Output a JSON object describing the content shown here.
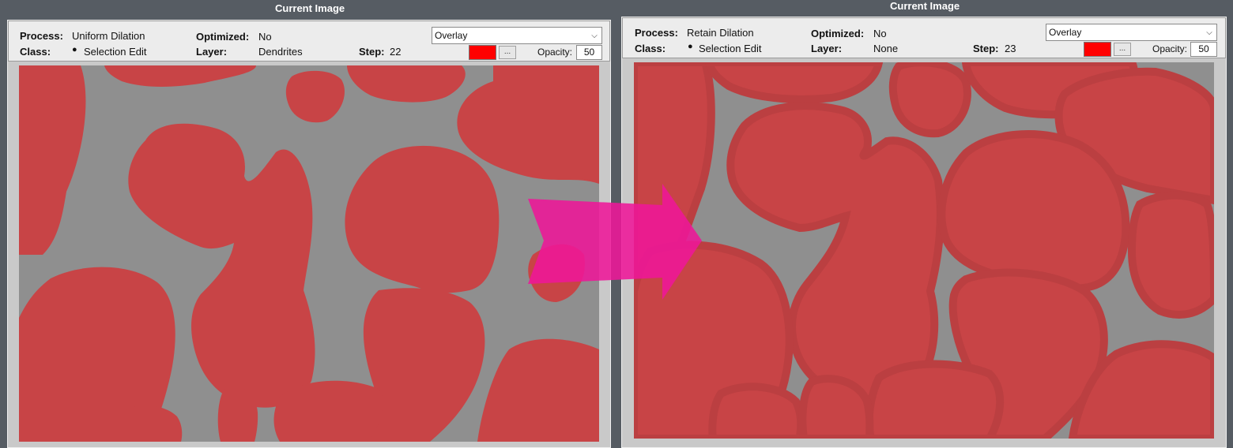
{
  "left": {
    "title": "Current Image",
    "process_label": "Process:",
    "process_value": "Uniform Dilation",
    "class_label": "Class:",
    "class_value": "Selection Edit",
    "optimized_label": "Optimized:",
    "optimized_value": "No",
    "layer_label": "Layer:",
    "layer_value": "Dendrites",
    "step_label": "Step:",
    "step_value": "22",
    "view_mode": "Overlay",
    "opacity_label": "Opacity:",
    "opacity_value": "50",
    "dots": "...",
    "bullet": "●"
  },
  "right": {
    "title": "Current Image",
    "process_label": "Process:",
    "process_value": "Retain Dilation",
    "class_label": "Class:",
    "class_value": "Selection Edit",
    "optimized_label": "Optimized:",
    "optimized_value": "No",
    "layer_label": "Layer:",
    "layer_value": "None",
    "step_label": "Step:",
    "step_value": "23",
    "view_mode": "Overlay",
    "opacity_label": "Opacity:",
    "opacity_value": "50",
    "dots": "...",
    "bullet": "●"
  },
  "colors": {
    "overlay": "#ff0000",
    "particle": "#c84446",
    "particle_core": "#cc4547",
    "matrix": "#8f8f8f",
    "arrow": "#ee1799"
  },
  "icons": {
    "dropdown": "chevron-down-icon",
    "bullet": "bullet-icon",
    "annotation": "arrow-right-icon"
  }
}
